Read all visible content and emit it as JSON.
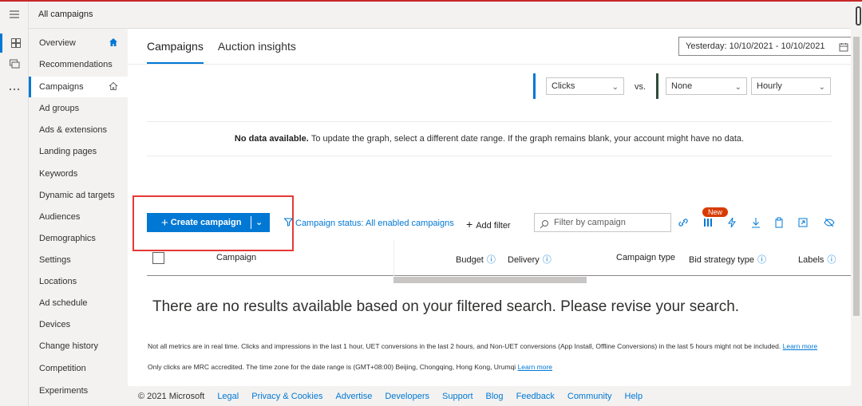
{
  "header": {
    "title": "All campaigns"
  },
  "sidebar": {
    "items": [
      {
        "label": "Overview"
      },
      {
        "label": "Recommendations"
      },
      {
        "label": "Campaigns"
      },
      {
        "label": "Ad groups"
      },
      {
        "label": "Ads & extensions"
      },
      {
        "label": "Landing pages"
      },
      {
        "label": "Keywords"
      },
      {
        "label": "Dynamic ad targets"
      },
      {
        "label": "Audiences"
      },
      {
        "label": "Demographics"
      },
      {
        "label": "Settings"
      },
      {
        "label": "Locations"
      },
      {
        "label": "Ad schedule"
      },
      {
        "label": "Devices"
      },
      {
        "label": "Change history"
      },
      {
        "label": "Competition"
      },
      {
        "label": "Experiments"
      }
    ]
  },
  "tabs": [
    {
      "label": "Campaigns"
    },
    {
      "label": "Auction insights"
    }
  ],
  "date_range": "Yesterday: 10/10/2021 - 10/10/2021",
  "chart_controls": {
    "metric1": "Clicks",
    "vs": "vs.",
    "metric2": "None",
    "granularity": "Hourly"
  },
  "no_data": {
    "bold": "No data available.",
    "text": "To update the graph, select a different date range. If the graph remains blank, your account might have no data."
  },
  "toolbar": {
    "create_label": "Create campaign",
    "status_filter": "Campaign status: All enabled campaigns",
    "add_filter": "Add filter",
    "search_placeholder": "Filter by campaign",
    "new_badge": "New"
  },
  "table": {
    "columns": [
      "Campaign",
      "Budget",
      "Delivery",
      "Campaign type",
      "Bid strategy type",
      "Labels"
    ]
  },
  "no_results": "There are no results available based on your filtered search. Please revise your search.",
  "footnote1": "Not all metrics are in real time. Clicks and impressions in the last 1 hour, UET conversions in the last 2 hours, and Non-UET conversions (App Install, Offline Conversions) in the last 5 hours might not be included.",
  "footnote1_link": "Learn more",
  "footnote2": "Only clicks are MRC accredited. The time zone for the date range is (GMT+08:00) Beijing, Chongqing, Hong Kong, Urumqi",
  "footnote2_link": "Learn more",
  "footer": {
    "copyright": "© 2021 Microsoft",
    "links": [
      "Legal",
      "Privacy & Cookies",
      "Advertise",
      "Developers",
      "Support",
      "Blog",
      "Feedback",
      "Community",
      "Help"
    ]
  },
  "colors": {
    "accent": "#0078d4",
    "highlight_box": "#e53935",
    "badge": "#d83b01"
  }
}
